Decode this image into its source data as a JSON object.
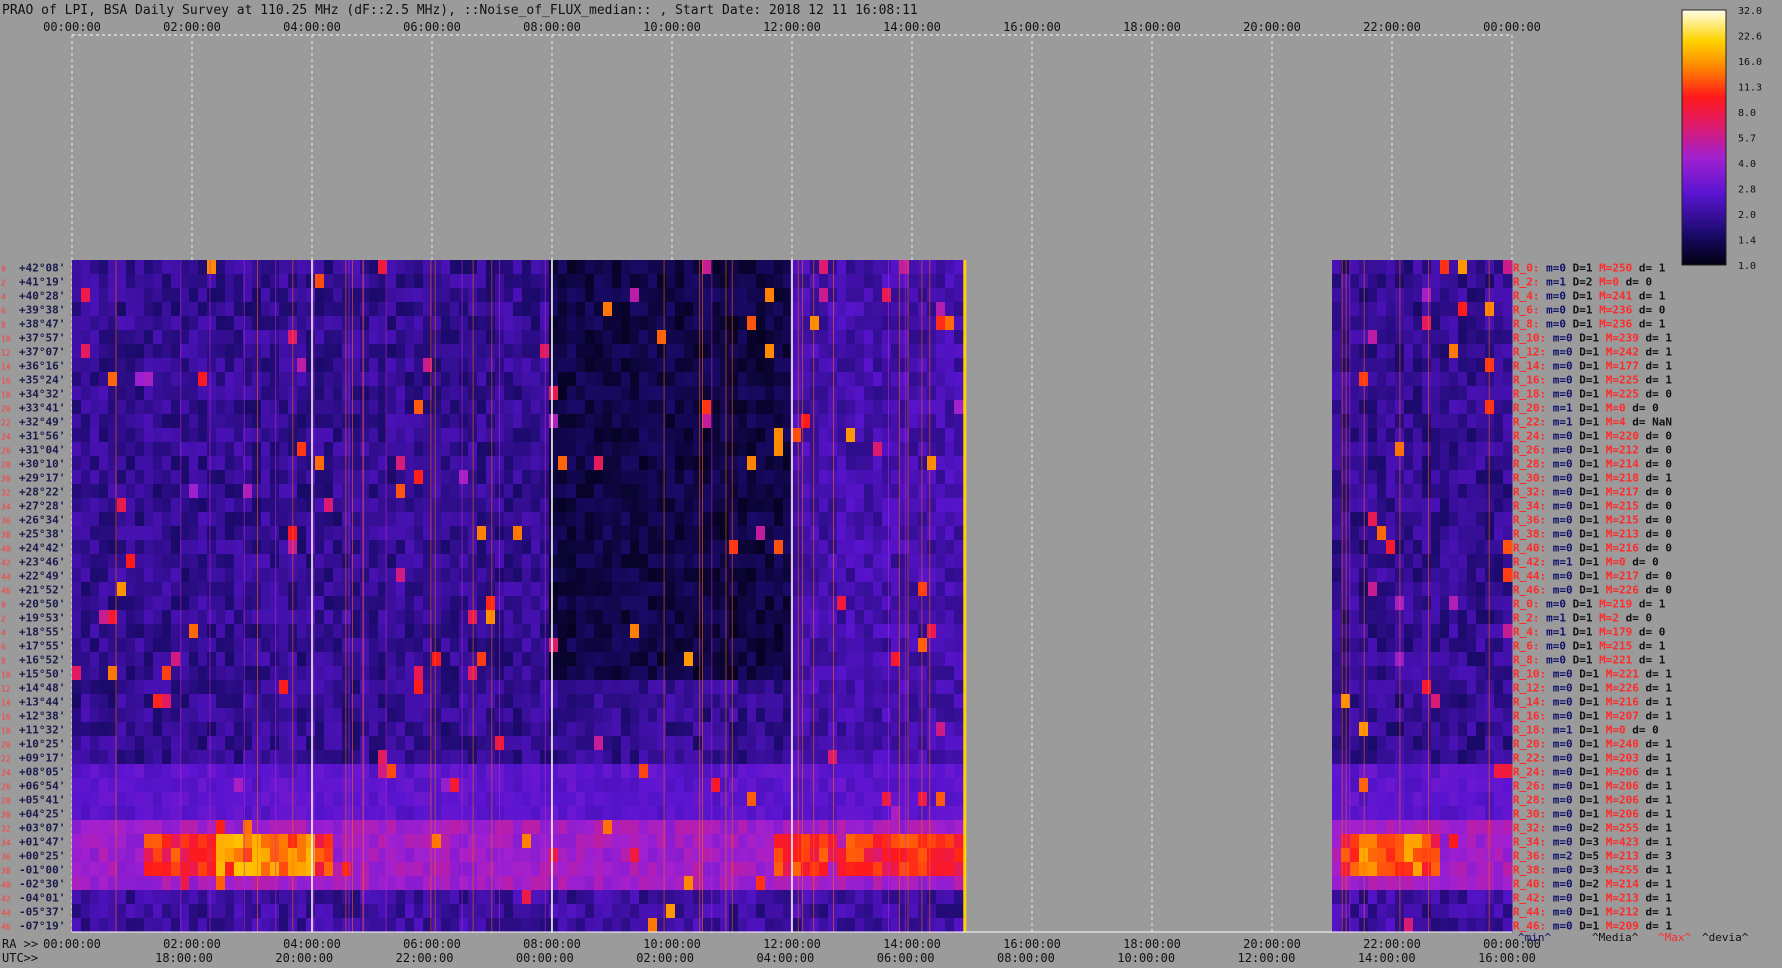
{
  "title": "PRAO of LPI, BSA Daily Survey at 110.25 MHz (dF::2.5 MHz), ::Noise_of_FLUX_median:: , Start Date: 2018 12 11 16:08:11",
  "colors": {
    "background": "#9b9b9b",
    "gridline": "#ffffff",
    "row_label": "#ff3b3b",
    "dec_label": "#1a1a4a",
    "stat_key": "#ff2a2a",
    "stat_val": "#10106a"
  },
  "chart_data": {
    "type": "heatmap",
    "top_axis_ticks": [
      "00:00:00",
      "02:00:00",
      "04:00:00",
      "06:00:00",
      "08:00:00",
      "10:00:00",
      "12:00:00",
      "14:00:00",
      "16:00:00",
      "18:00:00",
      "20:00:00",
      "22:00:00",
      "00:00:00"
    ],
    "bottom_ra_label": "RA >>",
    "bottom_ra_ticks": [
      "00:00:00",
      "02:00:00",
      "04:00:00",
      "06:00:00",
      "08:00:00",
      "10:00:00",
      "12:00:00",
      "14:00:00",
      "16:00:00",
      "18:00:00",
      "20:00:00",
      "22:00:00",
      "00:00:00"
    ],
    "bottom_utc_label": "UTC>>",
    "bottom_utc_ticks": [
      "18:00:00",
      "20:00:00",
      "22:00:00",
      "00:00:00",
      "02:00:00",
      "04:00:00",
      "06:00:00",
      "08:00:00",
      "10:00:00",
      "12:00:00",
      "14:00:00",
      "16:00:00"
    ],
    "declinations": [
      "+42°08'",
      "+41°19'",
      "+40°28'",
      "+39°38'",
      "+38°47'",
      "+37°57'",
      "+37°07'",
      "+36°16'",
      "+35°24'",
      "+34°32'",
      "+33°41'",
      "+32°49'",
      "+31°56'",
      "+31°04'",
      "+30°10'",
      "+29°17'",
      "+28°22'",
      "+27°28'",
      "+26°34'",
      "+25°38'",
      "+24°42'",
      "+23°46'",
      "+22°49'",
      "+21°52'",
      "+20°50'",
      "+19°53'",
      "+18°55'",
      "+17°55'",
      "+16°52'",
      "+15°50'",
      "+14°48'",
      "+13°44'",
      "+12°38'",
      "+11°32'",
      "+10°25'",
      "+09°17'",
      "+08°05'",
      "+06°54'",
      "+05°41'",
      "+04°25'",
      "+03°07'",
      "+01°47'",
      "+00°25'",
      "-01°00'",
      "-02°30'",
      "-04°01'",
      "-05°37'",
      "-07°19'"
    ],
    "row_numbers": [
      "0",
      "2",
      "4",
      "6",
      "8",
      "10",
      "12",
      "14",
      "16",
      "18",
      "20",
      "22",
      "24",
      "26",
      "28",
      "30",
      "32",
      "34",
      "36",
      "38",
      "40",
      "42",
      "44",
      "46",
      "0",
      "2",
      "4",
      "6",
      "8",
      "10",
      "12",
      "14",
      "16",
      "18",
      "20",
      "22",
      "24",
      "26",
      "28",
      "30",
      "32",
      "34",
      "36",
      "38",
      "40",
      "42",
      "44",
      "46"
    ],
    "data_coverage": [
      [
        0.0,
        0.62
      ],
      [
        0.875,
        1.0
      ]
    ],
    "colorbar": {
      "ticks": [
        "32.0",
        "22.6",
        "16.0",
        "11.3",
        "8.0",
        "5.7",
        "4.0",
        "2.8",
        "2.0",
        "1.4",
        "1.0"
      ],
      "min": 1.0,
      "max": 32.0,
      "scale": "log"
    },
    "stats_header": [
      "^min^",
      "^Media^",
      "^Max^",
      "^devia^"
    ],
    "stats": [
      {
        "r": "R_0:",
        "m": "m=0",
        "D": "D=1",
        "M": "M=250",
        "d": "d= 1"
      },
      {
        "r": "R_2:",
        "m": "m=1",
        "D": "D=2",
        "M": "M=0",
        "d": "d= 0"
      },
      {
        "r": "R_4:",
        "m": "m=0",
        "D": "D=1",
        "M": "M=241",
        "d": "d= 1"
      },
      {
        "r": "R_6:",
        "m": "m=0",
        "D": "D=1",
        "M": "M=236",
        "d": "d= 0"
      },
      {
        "r": "R_8:",
        "m": "m=0",
        "D": "D=1",
        "M": "M=236",
        "d": "d= 1"
      },
      {
        "r": "R_10:",
        "m": "m=0",
        "D": "D=1",
        "M": "M=239",
        "d": "d= 1"
      },
      {
        "r": "R_12:",
        "m": "m=0",
        "D": "D=1",
        "M": "M=242",
        "d": "d= 1"
      },
      {
        "r": "R_14:",
        "m": "m=0",
        "D": "D=1",
        "M": "M=177",
        "d": "d= 1"
      },
      {
        "r": "R_16:",
        "m": "m=0",
        "D": "D=1",
        "M": "M=225",
        "d": "d= 1"
      },
      {
        "r": "R_18:",
        "m": "m=0",
        "D": "D=1",
        "M": "M=225",
        "d": "d= 0"
      },
      {
        "r": "R_20:",
        "m": "m=1",
        "D": "D=1",
        "M": "M=0",
        "d": "d= 0"
      },
      {
        "r": "R_22:",
        "m": "m=1",
        "D": "D=1",
        "M": "M=4",
        "d": "d= NaN"
      },
      {
        "r": "R_24:",
        "m": "m=0",
        "D": "D=1",
        "M": "M=220",
        "d": "d= 0"
      },
      {
        "r": "R_26:",
        "m": "m=0",
        "D": "D=1",
        "M": "M=212",
        "d": "d= 0"
      },
      {
        "r": "R_28:",
        "m": "m=0",
        "D": "D=1",
        "M": "M=214",
        "d": "d= 0"
      },
      {
        "r": "R_30:",
        "m": "m=0",
        "D": "D=1",
        "M": "M=218",
        "d": "d= 1"
      },
      {
        "r": "R_32:",
        "m": "m=0",
        "D": "D=1",
        "M": "M=217",
        "d": "d= 0"
      },
      {
        "r": "R_34:",
        "m": "m=0",
        "D": "D=1",
        "M": "M=215",
        "d": "d= 0"
      },
      {
        "r": "R_36:",
        "m": "m=0",
        "D": "D=1",
        "M": "M=215",
        "d": "d= 0"
      },
      {
        "r": "R_38:",
        "m": "m=0",
        "D": "D=1",
        "M": "M=213",
        "d": "d= 0"
      },
      {
        "r": "R_40:",
        "m": "m=0",
        "D": "D=1",
        "M": "M=216",
        "d": "d= 0"
      },
      {
        "r": "R_42:",
        "m": "m=1",
        "D": "D=1",
        "M": "M=0",
        "d": "d= 0"
      },
      {
        "r": "R_44:",
        "m": "m=0",
        "D": "D=1",
        "M": "M=217",
        "d": "d= 0"
      },
      {
        "r": "R_46:",
        "m": "m=0",
        "D": "D=1",
        "M": "M=226",
        "d": "d= 0"
      },
      {
        "r": "R_0:",
        "m": "m=0",
        "D": "D=1",
        "M": "M=219",
        "d": "d= 1"
      },
      {
        "r": "R_2:",
        "m": "m=1",
        "D": "D=1",
        "M": "M=2",
        "d": "d= 0"
      },
      {
        "r": "R_4:",
        "m": "m=1",
        "D": "D=1",
        "M": "M=179",
        "d": "d= 0"
      },
      {
        "r": "R_6:",
        "m": "m=0",
        "D": "D=1",
        "M": "M=215",
        "d": "d= 1"
      },
      {
        "r": "R_8:",
        "m": "m=0",
        "D": "D=1",
        "M": "M=221",
        "d": "d= 1"
      },
      {
        "r": "R_10:",
        "m": "m=0",
        "D": "D=1",
        "M": "M=221",
        "d": "d= 1"
      },
      {
        "r": "R_12:",
        "m": "m=0",
        "D": "D=1",
        "M": "M=226",
        "d": "d= 1"
      },
      {
        "r": "R_14:",
        "m": "m=0",
        "D": "D=1",
        "M": "M=216",
        "d": "d= 1"
      },
      {
        "r": "R_16:",
        "m": "m=0",
        "D": "D=1",
        "M": "M=207",
        "d": "d= 1"
      },
      {
        "r": "R_18:",
        "m": "m=1",
        "D": "D=1",
        "M": "M=0",
        "d": "d= 0"
      },
      {
        "r": "R_20:",
        "m": "m=0",
        "D": "D=1",
        "M": "M=240",
        "d": "d= 1"
      },
      {
        "r": "R_22:",
        "m": "m=0",
        "D": "D=1",
        "M": "M=203",
        "d": "d= 1"
      },
      {
        "r": "R_24:",
        "m": "m=0",
        "D": "D=1",
        "M": "M=206",
        "d": "d= 1"
      },
      {
        "r": "R_26:",
        "m": "m=0",
        "D": "D=1",
        "M": "M=206",
        "d": "d= 1"
      },
      {
        "r": "R_28:",
        "m": "m=0",
        "D": "D=1",
        "M": "M=206",
        "d": "d= 1"
      },
      {
        "r": "R_30:",
        "m": "m=0",
        "D": "D=1",
        "M": "M=206",
        "d": "d= 1"
      },
      {
        "r": "R_32:",
        "m": "m=0",
        "D": "D=2",
        "M": "M=255",
        "d": "d= 1"
      },
      {
        "r": "R_34:",
        "m": "m=0",
        "D": "D=3",
        "M": "M=423",
        "d": "d= 1"
      },
      {
        "r": "R_36:",
        "m": "m=2",
        "D": "D=5",
        "M": "M=213",
        "d": "d= 3"
      },
      {
        "r": "R_38:",
        "m": "m=0",
        "D": "D=3",
        "M": "M=255",
        "d": "d= 1"
      },
      {
        "r": "R_40:",
        "m": "m=0",
        "D": "D=2",
        "M": "M=214",
        "d": "d= 1"
      },
      {
        "r": "R_42:",
        "m": "m=0",
        "D": "D=1",
        "M": "M=213",
        "d": "d= 1"
      },
      {
        "r": "R_44:",
        "m": "m=0",
        "D": "D=1",
        "M": "M=212",
        "d": "d= 1"
      },
      {
        "r": "R_46:",
        "m": "m=0",
        "D": "D=1",
        "M": "M=209",
        "d": "d= 1"
      }
    ]
  }
}
